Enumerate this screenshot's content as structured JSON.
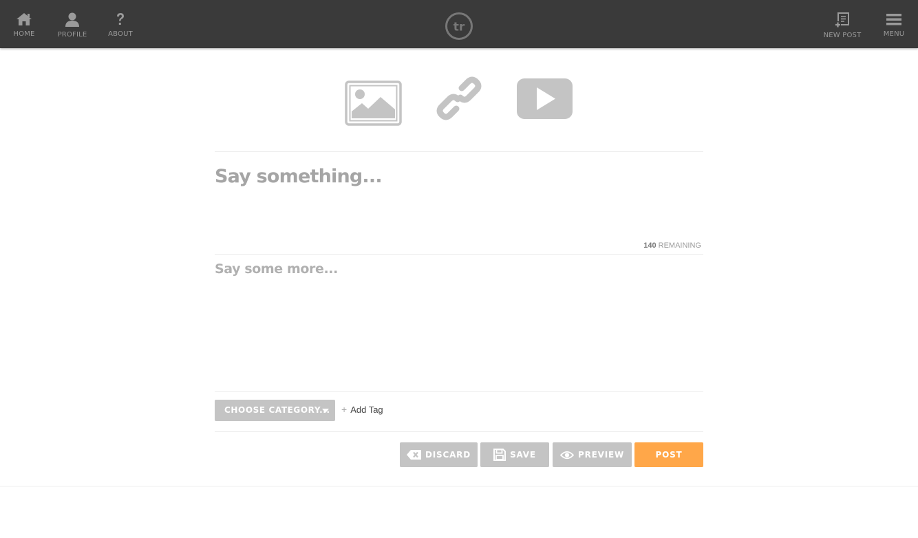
{
  "nav": {
    "left": [
      {
        "label": "HOME",
        "icon": "home-icon"
      },
      {
        "label": "PROFILE",
        "icon": "user-icon"
      },
      {
        "label": "ABOUT",
        "icon": "question-icon"
      }
    ],
    "logo_text": "tr",
    "right": [
      {
        "label": "NEW POST",
        "icon": "new-post-icon"
      },
      {
        "label": "MENU",
        "icon": "hamburger-icon"
      }
    ]
  },
  "media_types": [
    "image-icon",
    "link-icon",
    "video-play-icon"
  ],
  "composer": {
    "title_placeholder": "Say something...",
    "remaining_count": "140",
    "remaining_label": "REMAINING",
    "body_placeholder": "Say some more..."
  },
  "meta": {
    "category_label": "CHOOSE CATEGORY...",
    "add_tag_label": "Add Tag"
  },
  "actions": {
    "discard": "DISCARD",
    "save": "SAVE",
    "preview": "PREVIEW",
    "post": "POST"
  },
  "colors": {
    "topbar": "#3a3a3a",
    "icon_gray": "#c4c4c4",
    "post_orange": "#ffa749"
  }
}
